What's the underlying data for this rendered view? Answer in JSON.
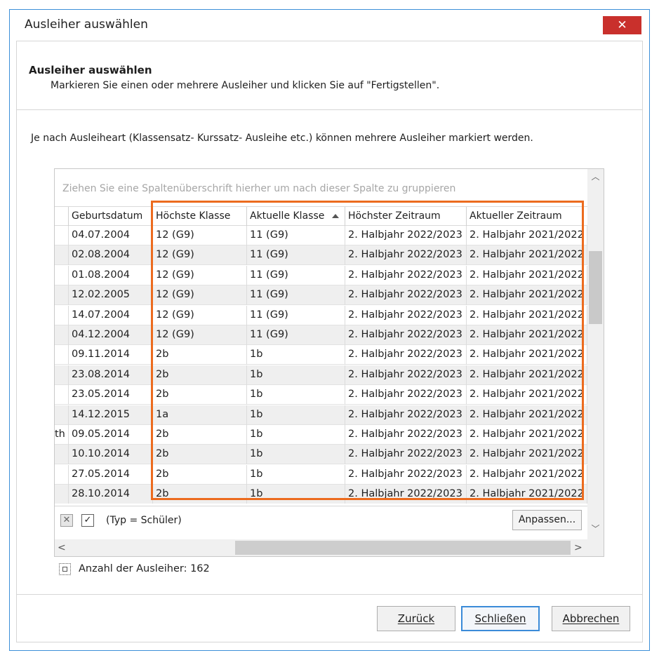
{
  "window": {
    "title": "Ausleiher auswählen",
    "close_glyph": "✕"
  },
  "header": {
    "title": "Ausleiher auswählen",
    "subtitle": "Markieren Sie einen oder mehrere Ausleiher und klicken Sie auf \"Fertigstellen\"."
  },
  "info_text": "Je nach Ausleiheart (Klassensatz- Kurssatz- Ausleihe etc.) können mehrere Ausleiher markiert werden.",
  "grid": {
    "group_panel_text": "Ziehen Sie eine Spaltenüberschrift hierher um nach dieser Spalte zu gruppieren",
    "columns": [
      "Geburtsdatum",
      "Höchste Klasse",
      "Aktuelle Klasse",
      "Höchster Zeitraum",
      "Aktueller Zeitraum"
    ],
    "sorted_column_index": 2,
    "sort_direction": "ascending",
    "rows": [
      {
        "prefix": "",
        "geb": "04.07.2004",
        "hk": "12 (G9)",
        "ak": "11 (G9)",
        "hz": "2. Halbjahr 2022/2023",
        "az": "2. Halbjahr 2021/2022"
      },
      {
        "prefix": "",
        "geb": "02.08.2004",
        "hk": "12 (G9)",
        "ak": "11 (G9)",
        "hz": "2. Halbjahr 2022/2023",
        "az": "2. Halbjahr 2021/2022"
      },
      {
        "prefix": "",
        "geb": "01.08.2004",
        "hk": "12 (G9)",
        "ak": "11 (G9)",
        "hz": "2. Halbjahr 2022/2023",
        "az": "2. Halbjahr 2021/2022"
      },
      {
        "prefix": "",
        "geb": "12.02.2005",
        "hk": "12 (G9)",
        "ak": "11 (G9)",
        "hz": "2. Halbjahr 2022/2023",
        "az": "2. Halbjahr 2021/2022"
      },
      {
        "prefix": "",
        "geb": "14.07.2004",
        "hk": "12 (G9)",
        "ak": "11 (G9)",
        "hz": "2. Halbjahr 2022/2023",
        "az": "2. Halbjahr 2021/2022"
      },
      {
        "prefix": "",
        "geb": "04.12.2004",
        "hk": "12 (G9)",
        "ak": "11 (G9)",
        "hz": "2. Halbjahr 2022/2023",
        "az": "2. Halbjahr 2021/2022"
      },
      {
        "prefix": "",
        "geb": "09.11.2014",
        "hk": "2b",
        "ak": "1b",
        "hz": "2. Halbjahr 2022/2023",
        "az": "2. Halbjahr 2021/2022"
      },
      {
        "prefix": "",
        "geb": "23.08.2014",
        "hk": "2b",
        "ak": "1b",
        "hz": "2. Halbjahr 2022/2023",
        "az": "2. Halbjahr 2021/2022"
      },
      {
        "prefix": "",
        "geb": "23.05.2014",
        "hk": "2b",
        "ak": "1b",
        "hz": "2. Halbjahr 2022/2023",
        "az": "2. Halbjahr 2021/2022"
      },
      {
        "prefix": "",
        "geb": "14.12.2015",
        "hk": "1a",
        "ak": "1b",
        "hz": "2. Halbjahr 2022/2023",
        "az": "2. Halbjahr 2021/2022"
      },
      {
        "prefix": "th",
        "geb": "09.05.2014",
        "hk": "2b",
        "ak": "1b",
        "hz": "2. Halbjahr 2022/2023",
        "az": "2. Halbjahr 2021/2022"
      },
      {
        "prefix": "",
        "geb": "10.10.2014",
        "hk": "2b",
        "ak": "1b",
        "hz": "2. Halbjahr 2022/2023",
        "az": "2. Halbjahr 2021/2022"
      },
      {
        "prefix": "",
        "geb": "27.05.2014",
        "hk": "2b",
        "ak": "1b",
        "hz": "2. Halbjahr 2022/2023",
        "az": "2. Halbjahr 2021/2022"
      },
      {
        "prefix": "",
        "geb": "28.10.2014",
        "hk": "2b",
        "ak": "1b",
        "hz": "2. Halbjahr 2022/2023",
        "az": "2. Halbjahr 2021/2022"
      }
    ],
    "filter": {
      "text": "(Typ = Schüler)",
      "enabled": true,
      "clear_glyph": "✕",
      "check_glyph": "✓"
    },
    "customize_label": "Anpassen..."
  },
  "count_label": "Anzahl der Ausleiher: 162",
  "buttons": {
    "back": "Zurück",
    "close": "Schließen",
    "cancel": "Abbrechen"
  },
  "colors": {
    "window_border": "#3c8fd8",
    "close_button": "#c9302c",
    "highlight": "#ec6b1e",
    "row_alt": "#efefef"
  },
  "icons": {
    "close": "close-icon",
    "sort": "sort-ascending-icon",
    "scroll_up": "chevron-up-icon",
    "scroll_down": "chevron-down-icon",
    "scroll_left": "chevron-left-icon",
    "scroll_right": "chevron-right-icon",
    "count": "selection-icon"
  }
}
